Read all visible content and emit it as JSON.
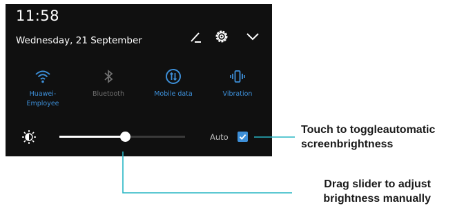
{
  "status": {
    "time": "11:58",
    "date": "Wednesday, 21 September"
  },
  "header_icons": [
    "edit-icon",
    "settings-gear-icon",
    "chevron-down-icon"
  ],
  "toggles": [
    {
      "id": "wifi",
      "label_lines": [
        "Huawei-",
        "Employee"
      ],
      "icon": "wifi-icon",
      "active": true
    },
    {
      "id": "bluetooth",
      "label_lines": [
        "Bluetooth"
      ],
      "icon": "bluetooth-icon",
      "active": false
    },
    {
      "id": "mobile-data",
      "label_lines": [
        "Mobile data"
      ],
      "icon": "mobile-data-icon",
      "active": true
    },
    {
      "id": "vibration",
      "label_lines": [
        "Vibration"
      ],
      "icon": "vibration-icon",
      "active": true
    }
  ],
  "brightness": {
    "level": 0.52,
    "auto_label": "Auto",
    "auto_checked": true
  },
  "annotations": {
    "auto": {
      "lines": [
        "Touch to toggleautomatic",
        "screenbrightness"
      ]
    },
    "slider": {
      "lines": [
        "Drag slider to adjust",
        "brightness manually"
      ]
    }
  },
  "colors": {
    "panel_bg": "#101010",
    "accent": "#3d8fd8",
    "inactive": "#6f6f6f",
    "callout_line": "#27b5c4"
  }
}
